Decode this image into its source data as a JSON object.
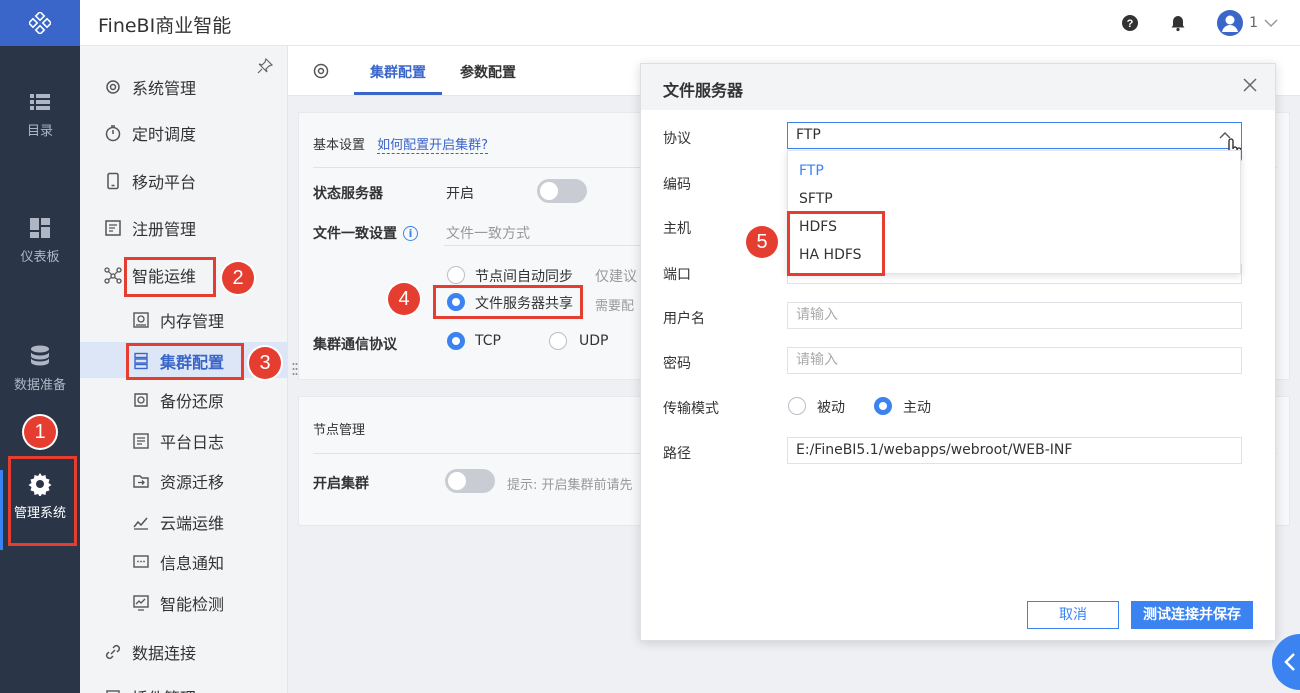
{
  "app": {
    "title": "FineBI商业智能",
    "user_count": "1"
  },
  "rail": {
    "items": [
      {
        "label": "目录",
        "icon": "list-icon"
      },
      {
        "label": "仪表板",
        "icon": "dashboard-icon"
      },
      {
        "label": "数据准备",
        "icon": "database-icon"
      },
      {
        "label": "管理系统",
        "icon": "gear-icon"
      }
    ]
  },
  "submenu": {
    "items": [
      {
        "label": "系统管理",
        "icon": "gear-icon"
      },
      {
        "label": "定时调度",
        "icon": "timer-icon"
      },
      {
        "label": "移动平台",
        "icon": "mobile-icon"
      },
      {
        "label": "注册管理",
        "icon": "register-icon"
      },
      {
        "label": "智能运维",
        "icon": "network-icon"
      },
      {
        "label": "内存管理",
        "icon": "memory-icon"
      },
      {
        "label": "集群配置",
        "icon": "cluster-icon"
      },
      {
        "label": "备份还原",
        "icon": "backup-icon"
      },
      {
        "label": "平台日志",
        "icon": "log-icon"
      },
      {
        "label": "资源迁移",
        "icon": "migrate-icon"
      },
      {
        "label": "云端运维",
        "icon": "cloud-icon"
      },
      {
        "label": "信息通知",
        "icon": "message-icon"
      },
      {
        "label": "智能检测",
        "icon": "monitor-icon"
      },
      {
        "label": "数据连接",
        "icon": "link-icon"
      },
      {
        "label": "插件管理",
        "icon": "plugin-icon"
      }
    ]
  },
  "tabs": [
    {
      "label": "集群配置",
      "active": true
    },
    {
      "label": "参数配置",
      "active": false
    }
  ],
  "basic": {
    "heading": "基本设置",
    "help_link": "如何配置开启集群?",
    "status_server_label": "状态服务器",
    "status_server_value": "开启",
    "file_consistency_label": "文件一致设置",
    "file_consistency_mode": "文件一致方式",
    "option_auto_sync": "节点间自动同步",
    "option_auto_sync_note": "仅建议",
    "option_file_server": "文件服务器共享",
    "option_file_server_note": "需要配",
    "protocol_label": "集群通信协议",
    "protocol_tcp": "TCP",
    "protocol_udp": "UDP"
  },
  "nodes": {
    "heading": "节点管理",
    "enable_label": "开启集群",
    "hint": "提示: 开启集群前请先"
  },
  "dialog": {
    "title": "文件服务器",
    "fields": {
      "protocol_label": "协议",
      "protocol_value": "FTP",
      "encoding_label": "编码",
      "host_label": "主机",
      "port_label": "端口",
      "username_label": "用户名",
      "username_placeholder": "请输入",
      "password_label": "密码",
      "password_placeholder": "请输入",
      "transfer_label": "传输模式",
      "transfer_passive": "被动",
      "transfer_active": "主动",
      "path_label": "路径",
      "path_value": "E:/FineBI5.1/webapps/webroot/WEB-INF"
    },
    "protocol_options": [
      "FTP",
      "SFTP",
      "HDFS",
      "HA HDFS"
    ],
    "cancel_label": "取消",
    "save_label": "测试连接并保存"
  },
  "annotations": [
    "1",
    "2",
    "3",
    "4",
    "5"
  ],
  "colors": {
    "accent": "#3a83f1",
    "brand": "#3a65c9",
    "rail": "#2a3648",
    "annotation": "#e53d30"
  }
}
